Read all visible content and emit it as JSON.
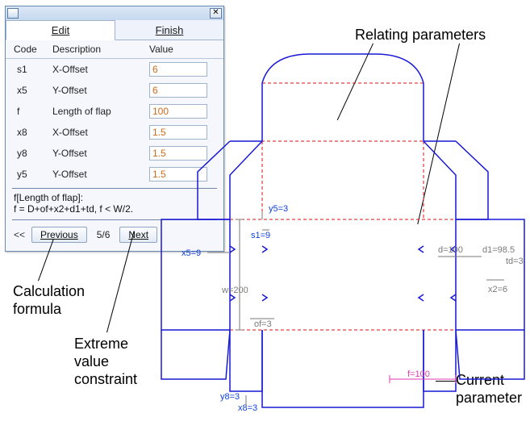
{
  "dialog": {
    "tabs": {
      "edit": "Edit",
      "finish": "Finish"
    },
    "headers": {
      "code": "Code",
      "desc": "Description",
      "value": "Value"
    },
    "rows": [
      {
        "code": "s1",
        "desc": "X-Offset",
        "value": "6"
      },
      {
        "code": "x5",
        "desc": "Y-Offset",
        "value": "6"
      },
      {
        "code": "f",
        "desc": "Length of flap",
        "value": "100"
      },
      {
        "code": "x8",
        "desc": "X-Offset",
        "value": "1.5"
      },
      {
        "code": "y8",
        "desc": "Y-Offset",
        "value": "1.5"
      },
      {
        "code": "y5",
        "desc": "Y-Offset",
        "value": "1.5"
      }
    ],
    "formula_title": "f[Length of flap]:",
    "formula_body": "f = D+of+x2+d1+td, f < W/2.",
    "nav": {
      "chevrons": "<<",
      "previous": "Previous",
      "page": "5/6",
      "next": "Next"
    }
  },
  "annotations": {
    "relating_parameters": "Relating parameters",
    "calculation_formula": "Calculation\nformula",
    "extreme_value_constraint": "Extreme\nvalue\nconstraint",
    "current_parameter": "Current\nparameter"
  },
  "dims": {
    "y5": "y5=3",
    "s1": "s1=9",
    "x5": "x5=9",
    "d": "d=100",
    "d1": "d1=98.5",
    "td": "td=3",
    "w": "w=200",
    "x2": "x2=6",
    "of": "of=3",
    "f": "f=100",
    "y8": "y8=3",
    "x8": "x8=3"
  }
}
